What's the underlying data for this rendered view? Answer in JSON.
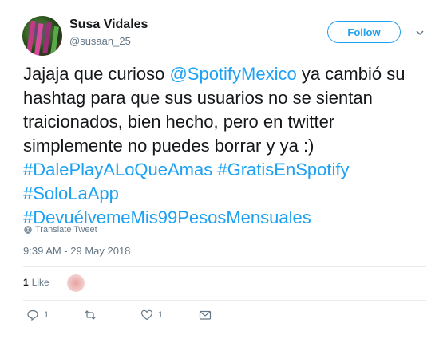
{
  "user": {
    "display_name": "Susa Vidales",
    "handle": "@susaan_25"
  },
  "follow_button": {
    "label": "Follow"
  },
  "tweet": {
    "text_plain_1": "Jajaja que curioso ",
    "mention": "@SpotifyMexico",
    "text_plain_2": " ya cambió su hashtag para que sus usuarios no se sientan traicionados, bien hecho, pero en twitter simplemente no puedes borrar y ya :) ",
    "hashtag_1": "#DalePlayALoQueAmas",
    "hashtag_2": "#GratisEnSpotify",
    "hashtag_3": "#SoloLaApp",
    "hashtag_4": "#DevuélvemeMis99PesosMensuales"
  },
  "translate": {
    "label": "Translate Tweet",
    "icon": "globe-icon"
  },
  "timestamp": "9:39 AM - 29 May 2018",
  "likes": {
    "count": "1",
    "label": "Like"
  },
  "actions": {
    "reply_count": "1",
    "retweet_count": "",
    "like_count": "1"
  },
  "colors": {
    "accent": "#1da1f2",
    "text": "#14171a",
    "muted": "#657786"
  }
}
